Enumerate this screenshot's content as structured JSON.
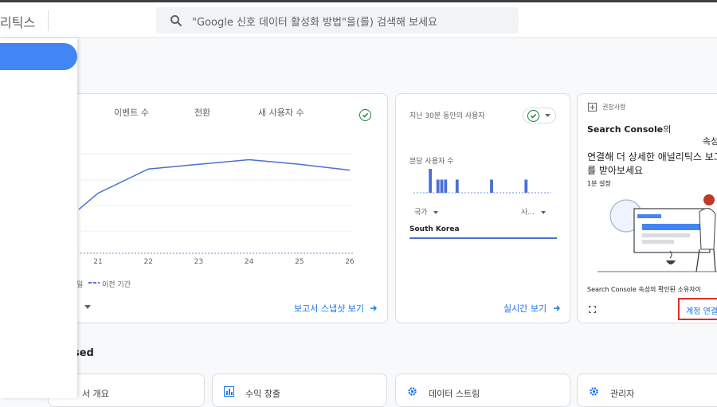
{
  "header": {
    "logo_text": "리틱스",
    "search_placeholder": "\"Google 신호 데이터 활성화 방법\"을(를) 검색해 보세요"
  },
  "overview_card": {
    "tabs": [
      "이벤트 수",
      "전환",
      "새 사용자 수"
    ],
    "legend_prev_fragment": "일",
    "legend_prev": "이전 기간",
    "footer_link": "보고서 스냅샷 보기",
    "chart_data": {
      "type": "line",
      "x": [
        "21",
        "22",
        "23",
        "24",
        "25",
        "26"
      ],
      "series": [
        {
          "values": [
            0.52,
            0.73,
            0.77,
            0.81,
            0.77,
            0.72
          ]
        }
      ],
      "xlabel": "",
      "ylabel": ""
    }
  },
  "realtime_card": {
    "title": "지난 30분 동안의 사용자",
    "minute_label": "분당 사용자 수",
    "col1": "국가",
    "col2": "사...",
    "row1_country": "South Korea",
    "footer_link": "실시간 보기",
    "chart_data": {
      "type": "bar",
      "values": [
        0,
        0,
        0,
        0,
        1,
        0,
        0.55,
        0.55,
        0.55,
        0,
        0,
        0.55,
        0,
        0,
        0,
        0,
        0,
        0,
        0,
        0,
        0.55,
        0,
        0,
        0,
        0,
        0,
        0,
        0,
        0,
        0.55,
        0,
        0,
        0,
        0,
        0,
        0
      ]
    }
  },
  "recommendation_card": {
    "tag": "권장사항",
    "title_bold": "Search Console",
    "title_suffix": "의",
    "line2": "속성",
    "line3": "연결해 더 상세한 애널리틱스 보고",
    "line4": "를 받아보세요",
    "time": "1분 설정",
    "note": "Search Console 속성의 확인된 소유자이",
    "cta": "계정 연결"
  },
  "section_heading": "ccessed",
  "bottom_cards": [
    {
      "label": "서 개요"
    },
    {
      "label": "수익 창출"
    },
    {
      "label": "데이터 스트림"
    },
    {
      "label": "관리자"
    }
  ]
}
